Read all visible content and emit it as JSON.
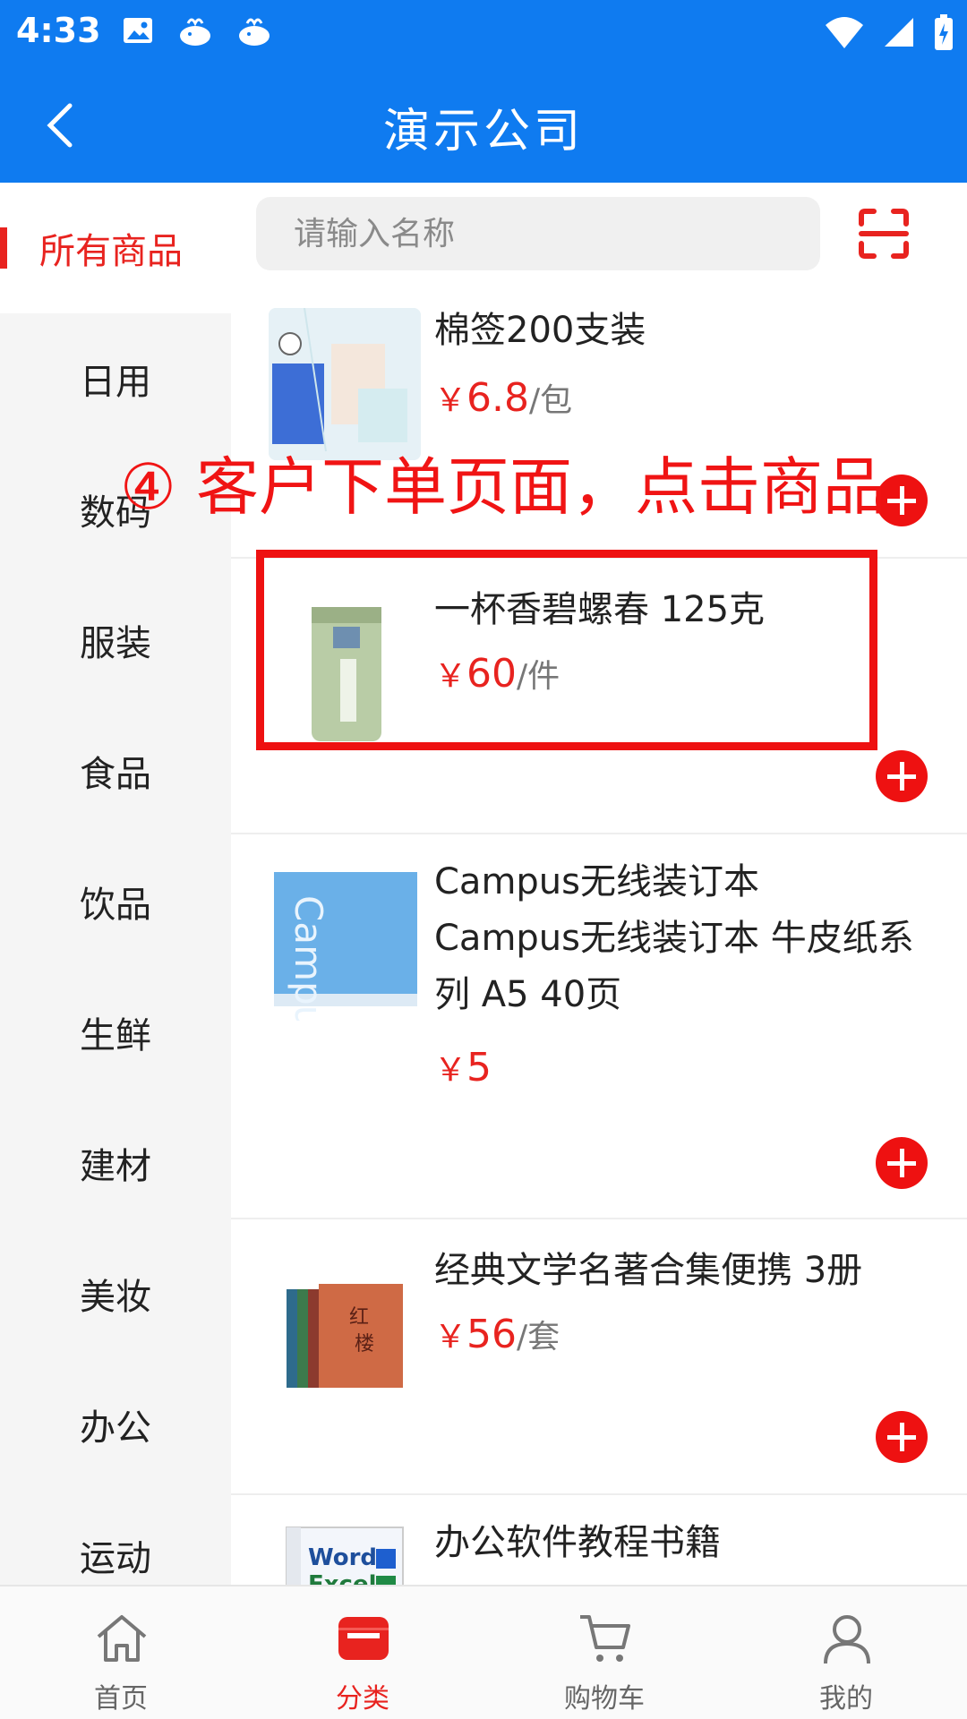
{
  "status_bar": {
    "time": "4:33"
  },
  "header": {
    "title": "演示公司"
  },
  "search": {
    "placeholder": "请输入名称"
  },
  "sidebar": {
    "items": [
      {
        "label": "所有商品",
        "active": true
      },
      {
        "label": "日用"
      },
      {
        "label": "数码"
      },
      {
        "label": "服装"
      },
      {
        "label": "食品"
      },
      {
        "label": "饮品"
      },
      {
        "label": "生鲜"
      },
      {
        "label": "建材"
      },
      {
        "label": "美妆"
      },
      {
        "label": "办公"
      },
      {
        "label": "运动"
      }
    ]
  },
  "products": [
    {
      "name": "棉签200支装",
      "yen": "￥",
      "price": "6.8",
      "unit": "/包"
    },
    {
      "name": "一杯香碧螺春 125克",
      "yen": "￥",
      "price": "60",
      "unit": "/件"
    },
    {
      "name": "Campus无线装订本\n Campus无线装订本 牛皮纸系列 A5 40页",
      "yen": "￥",
      "price": "5",
      "unit": ""
    },
    {
      "name": "经典文学名著合集便携 3册",
      "yen": "￥",
      "price": "56",
      "unit": "/套"
    },
    {
      "name": "办公软件教程书籍",
      "yen": "",
      "price": "",
      "unit": ""
    }
  ],
  "annotation": {
    "text": "④ 客户下单页面，点击商品"
  },
  "bottom_nav": {
    "items": [
      {
        "label": "首页"
      },
      {
        "label": "分类",
        "active": true
      },
      {
        "label": "购物车"
      },
      {
        "label": "我的"
      }
    ]
  },
  "colors": {
    "primary": "#0f7bf0",
    "accent": "#e8231f",
    "sidebar_bg": "#f5f5f5"
  }
}
